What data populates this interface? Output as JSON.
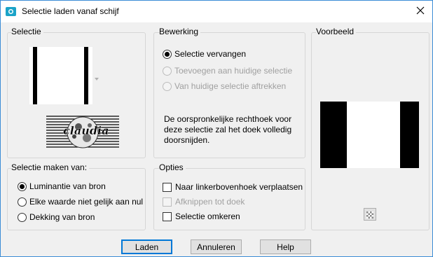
{
  "window": {
    "title": "Selectie laden vanaf schijf",
    "close_icon": "close-icon",
    "app_icon": "psp-icon"
  },
  "selectie": {
    "legend": "Selectie",
    "logo_text": "claudia"
  },
  "bewerking": {
    "legend": "Bewerking",
    "options": [
      {
        "label": "Selectie vervangen",
        "checked": true,
        "disabled": false
      },
      {
        "label": "Toevoegen aan huidige selectie",
        "checked": false,
        "disabled": true
      },
      {
        "label": "Van huidige selectie aftrekken",
        "checked": false,
        "disabled": true
      }
    ],
    "info": "De oorspronkelijke rechthoek voor deze selectie zal het doek volledig doorsnijden."
  },
  "voorbeeld": {
    "legend": "Voorbeeld"
  },
  "maken_van": {
    "legend": "Selectie maken van:",
    "options": [
      {
        "label": "Luminantie van bron",
        "checked": true
      },
      {
        "label": "Elke waarde niet gelijk aan nul",
        "checked": false
      },
      {
        "label": "Dekking van bron",
        "checked": false
      }
    ]
  },
  "opties": {
    "legend": "Opties",
    "options": [
      {
        "label": "Naar linkerbovenhoek verplaatsen",
        "checked": false,
        "disabled": false
      },
      {
        "label": "Afknippen tot doek",
        "checked": false,
        "disabled": true
      },
      {
        "label": "Selectie omkeren",
        "checked": false,
        "disabled": false
      }
    ]
  },
  "buttons": {
    "load": "Laden",
    "cancel": "Annuleren",
    "help": "Help"
  }
}
